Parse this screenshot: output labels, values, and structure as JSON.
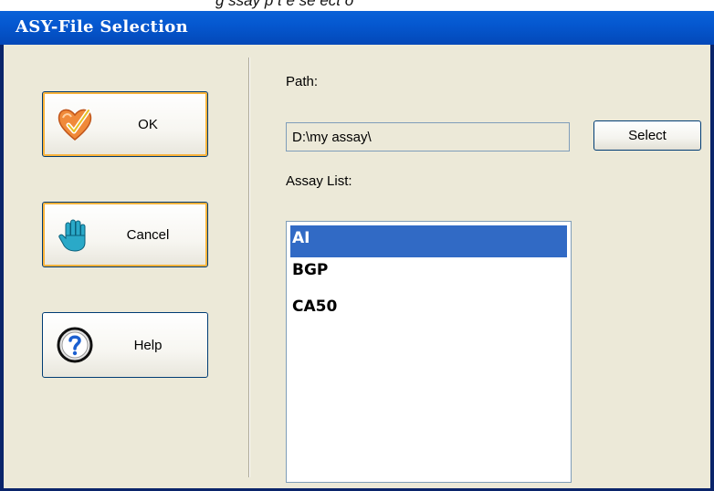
{
  "caption_fragment": "g       ssay  p  t   e  se  ect o",
  "window": {
    "title": "ASY-File Selection"
  },
  "buttons": {
    "ok": {
      "label": "OK",
      "icon": "heart-check-icon"
    },
    "cancel": {
      "label": "Cancel",
      "icon": "hand-stop-icon"
    },
    "help": {
      "label": "Help",
      "icon": "question-icon"
    },
    "select": {
      "label": "Select"
    }
  },
  "path": {
    "label": "Path:",
    "value": "D:\\my assay\\"
  },
  "assay_list": {
    "label": "Assay List:",
    "items": [
      {
        "label": "AI",
        "selected": true
      },
      {
        "label": "BGP",
        "selected": false
      },
      {
        "label": "CA50",
        "selected": false
      }
    ]
  },
  "colors": {
    "titlebar": "#0558d0",
    "client_bg": "#ece9d8",
    "selection": "#316ac5",
    "focus_ring": "#f8b33c"
  }
}
